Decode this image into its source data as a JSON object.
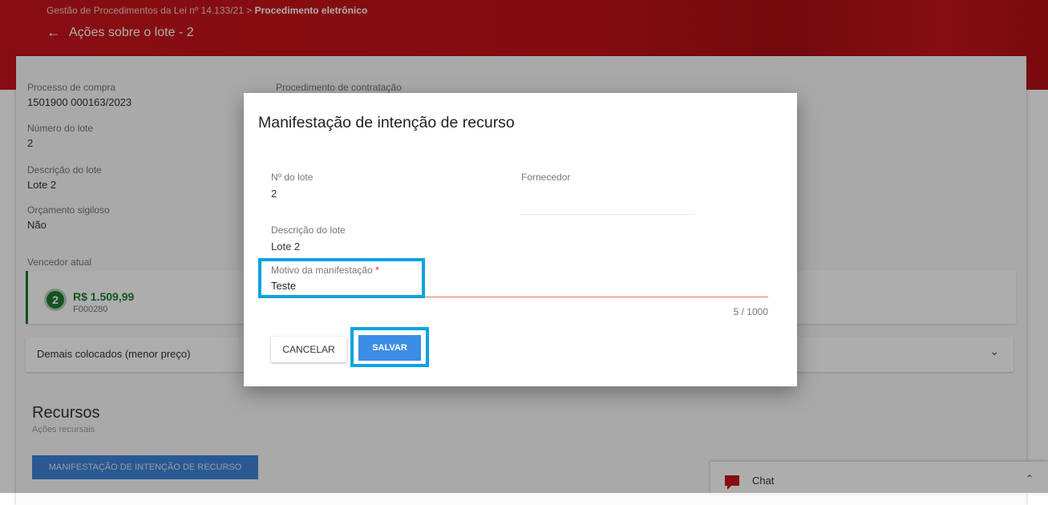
{
  "header": {
    "breadcrumb_prefix": "Gestão de Procedimentos da Lei nº 14.133/21 >",
    "breadcrumb_current": "Procedimento eletrônico",
    "back_arrow": "←",
    "title": "Ações sobre o lote - 2"
  },
  "details": {
    "processo_label": "Processo de compra",
    "processo_value": "1501900 000163/2023",
    "procedimento_label": "Procedimento de contratação",
    "numero_label": "Número do lote",
    "numero_value": "2",
    "descricao_label": "Descrição do lote",
    "descricao_value": "Lote 2",
    "orcamento_label": "Orçamento sigiloso",
    "orcamento_value": "Não",
    "vencedor_label": "Vencedor atual"
  },
  "winner": {
    "rank": "2",
    "price": "R$ 1.509,99",
    "vendor": "F000280",
    "accent": "#1e7b30"
  },
  "accordion": {
    "label": "Demais colocados (menor preço)",
    "icon": "chevron-down-icon"
  },
  "recursos": {
    "title": "Recursos",
    "subtitle": "Ações recursais",
    "button": "MANIFESTAÇÃO DE INTENÇÃO DE RECURSO"
  },
  "chat": {
    "label": "Chat",
    "icon": "chat-icon",
    "toggle_icon": "chevron-up-icon"
  },
  "dialog": {
    "title": "Manifestação de intenção de recurso",
    "lote_label": "Nº do lote",
    "lote_value": "2",
    "fornecedor_label": "Fornecedor",
    "descricao_label": "Descrição do lote",
    "descricao_value": "Lote 2",
    "motivo_label": "Motivo da manifestação",
    "motivo_required": "*",
    "motivo_value": "Teste",
    "counter": "5 / 1000",
    "cancel_label": "CANCELAR",
    "save_label": "SALVAR"
  },
  "colors": {
    "brand_red": "#c8141b",
    "primary_blue": "#3c8de4",
    "highlight_cyan": "#0aa3e2",
    "error_red": "#e57373"
  }
}
